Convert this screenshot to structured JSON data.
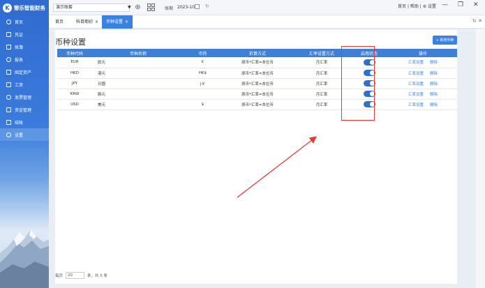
{
  "app": {
    "logo_glyph": "K",
    "name": "黎乐智能财务"
  },
  "sidebar": {
    "items": [
      {
        "label": "首页",
        "icon": "home-icon"
      },
      {
        "label": "凭证",
        "icon": "voucher-icon"
      },
      {
        "label": "账簿",
        "icon": "ledger-icon"
      },
      {
        "label": "报表",
        "icon": "report-icon"
      },
      {
        "label": "固定资产",
        "icon": "asset-icon"
      },
      {
        "label": "工资",
        "icon": "salary-icon"
      },
      {
        "label": "发票管理",
        "icon": "invoice-icon"
      },
      {
        "label": "资金管理",
        "icon": "fund-icon"
      },
      {
        "label": "结账",
        "icon": "close-books-icon"
      },
      {
        "label": "设置",
        "icon": "settings-icon"
      }
    ],
    "active_index": 9
  },
  "header": {
    "account": "演示账套",
    "period_label": "账期",
    "period_value": "2023-10",
    "links": "首页 | 帮助 | ⚙ 设置",
    "win_min": "—",
    "win_max": "❐",
    "win_close": "✕"
  },
  "tabs": [
    {
      "label": "首页",
      "closable": false
    },
    {
      "label": "科目期初",
      "closable": true
    },
    {
      "label": "币种设置",
      "closable": true
    }
  ],
  "tab_close": "×",
  "page": {
    "title": "币种设置",
    "add_button": "+ 新增币种",
    "columns": [
      "币种代码",
      "币种名称",
      "币符",
      "折算方式",
      "汇率设置方式",
      "启用状态",
      "操作"
    ],
    "rows": [
      {
        "code": "EUR",
        "name": "欧元",
        "symbol": "€",
        "method": "原币*汇率=本位币",
        "rate_mode": "月汇率",
        "enabled": true
      },
      {
        "code": "HKD",
        "name": "港元",
        "symbol": "HK$",
        "method": "原币*汇率=本位币",
        "rate_mode": "月汇率",
        "enabled": true
      },
      {
        "code": "JPY",
        "name": "日圆",
        "symbol": "J￥",
        "method": "原币*汇率=本位币",
        "rate_mode": "月汇率",
        "enabled": true
      },
      {
        "code": "KRW",
        "name": "韩元",
        "symbol": "",
        "method": "原币*汇率=本位币",
        "rate_mode": "月汇率",
        "enabled": true
      },
      {
        "code": "USD",
        "name": "美元",
        "symbol": "$",
        "method": "原币*汇率=本位币",
        "rate_mode": "月汇率",
        "enabled": true
      }
    ],
    "action_rate": "汇率设置",
    "action_delete": "删除",
    "footer": {
      "per_page_label": "每页",
      "per_page_value": "20",
      "summary": "条，共 5 条"
    }
  },
  "colors": {
    "accent": "#3b82e0",
    "header_row": "#3f7fd6",
    "annotation": "#e53935"
  }
}
